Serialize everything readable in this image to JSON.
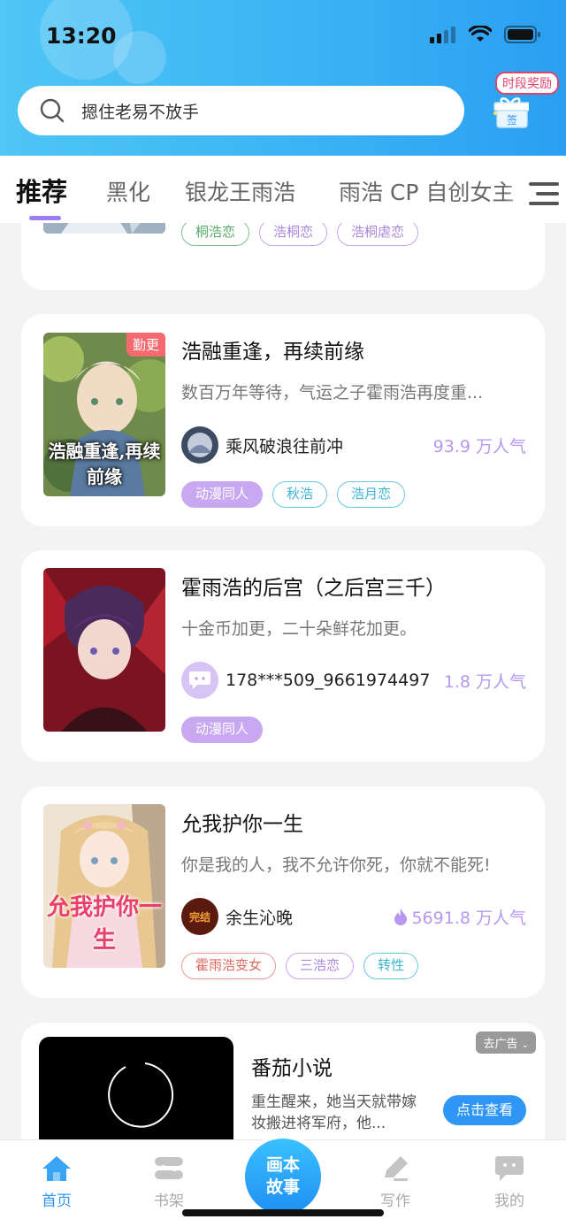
{
  "status": {
    "time": "13:20"
  },
  "search": {
    "placeholder": "摁住老易不放手"
  },
  "reward": {
    "label": "时段奖励",
    "gift_label": "签"
  },
  "tabs": [
    {
      "label": "推荐",
      "active": true
    },
    {
      "label": "黑化",
      "active": false
    },
    {
      "label": "银龙王雨浩",
      "active": false
    },
    {
      "label": "雨浩 CP 自创女主",
      "active": false
    }
  ],
  "feed": {
    "partial_card": {
      "tags": [
        "桐浩恋",
        "浩桐恋",
        "浩桐虐恋"
      ]
    },
    "books": [
      {
        "badge": "勤更",
        "cover_text": "浩融重逢,再续前缘",
        "title": "浩融重逢，再续前缘",
        "desc": "数百万年等待，气运之子霍雨浩再度重...",
        "author": "乘风破浪往前冲",
        "popularity": "93.9 万人气",
        "tags": [
          "动漫同人",
          "秋浩",
          "浩月恋"
        ]
      },
      {
        "title": "霍雨浩的后宫（之后宫三千）",
        "desc": "十金币加更，二十朵鲜花加更。",
        "author": "178***509_9661974497",
        "popularity": "1.8 万人气",
        "tags": [
          "动漫同人"
        ]
      },
      {
        "cover_text": "允我护你一生",
        "title": "允我护你一生",
        "desc": "你是我的人，我不允许你死，你就不能死!",
        "author": "余生沁晚",
        "avatar_text": "完结",
        "popularity": "5691.8 万人气",
        "tags": [
          "霍雨浩变女",
          "三浩恋",
          "转性"
        ]
      }
    ],
    "ad": {
      "remove_label": "去广告",
      "title": "番茄小说",
      "desc": "重生醒来，她当天就带嫁妆搬进将军府，他...",
      "cta": "点击查看"
    }
  },
  "nav": {
    "home": "首页",
    "shelf": "书架",
    "center": "画本故事",
    "write": "写作",
    "mine": "我的"
  },
  "colors": {
    "accent": "#2f96f6",
    "header": "#3cb2f4",
    "popularity": "#b798f0",
    "tag_fill": "#c8a8f0"
  }
}
